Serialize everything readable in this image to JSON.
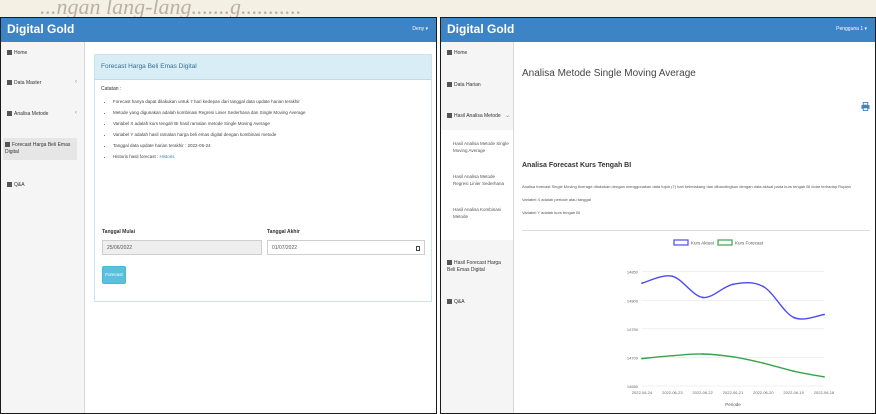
{
  "caption_strip": "...ngan lang-lang.......g...........",
  "left": {
    "app_title": "Digital Gold",
    "user_label": "Deny ▾",
    "sidebar": [
      {
        "label": "Home"
      },
      {
        "label": "Data Master"
      },
      {
        "label": "Analisa Metode"
      },
      {
        "label": "Forecast Harga Beli Emas Digital"
      },
      {
        "label": "Q&A"
      }
    ],
    "panel_title": "Forecast Harga Beli Emas Digital",
    "note_title": "Catatan :",
    "notes": [
      "Forecast hanya dapat dilakukan untuk 7 hari kedepan dari tanggal data update harian terakhir",
      "Metode yang digunakan adalah kombinasi Regresi Linier Sederhana dan Single Moving Average",
      "Variabel X adalah kurs tengah BI hasil ramalan metode Single Moving Average",
      "Variabel Y adalah hasil ramalan harga beli emas digital dengan kombinasi metode",
      "Tanggal data update harian terakhir : 2022-06-24"
    ],
    "history_prefix": "Historis hasil forecast :",
    "history_link": "Historis",
    "tanggal_mulai_label": "Tanggal Mulai",
    "tanggal_mulai_value": "25/06/2022",
    "tanggal_akhir_label": "Tanggal Akhir",
    "tanggal_akhir_value": "01/07/2022",
    "forecast_button": "Forecast"
  },
  "right": {
    "app_title": "Digital Gold",
    "user_label": "Pengguna 1 ▾",
    "sidebar": [
      {
        "label": "Home"
      },
      {
        "label": "Data Harian"
      },
      {
        "label": "Hasil Analisa Metode"
      }
    ],
    "sidebar_sub": [
      {
        "label": "Hasil Analisa Metode Single Moving Average"
      },
      {
        "label": "Hasil Analisa Metode Regresi Linier Sederhana"
      },
      {
        "label": "Hasil Analisa Kombinasi Metode"
      }
    ],
    "sidebar_after": [
      {
        "label": "Hasil Forecast Harga Beli Emas Digital"
      },
      {
        "label": "Q&A"
      }
    ],
    "page_title": "Analisa Metode Single Moving Average",
    "section_title": "Analisa Forecast Kurs Tengah BI",
    "desc_line1": "Analisa forecast Single Moving Average dilakukan dengan menggunakan data tujuh (7) hari kebelakang dan dibandingkan dengan data aktual pada kurs tengah BI dolar terhadap Rupiah",
    "desc_line2": "Variabel X adalah periode atau tanggal",
    "desc_line3": "Variabel Y adalah kurs tengah BI"
  },
  "chart_data": {
    "type": "line",
    "categories": [
      "2022-06-24",
      "2022-06-23",
      "2022-06-22",
      "2022-06-21",
      "2022-06-20",
      "2022-06-19",
      "2022-06-18"
    ],
    "series": [
      {
        "name": "Kurs Aktual",
        "values": [
          14830,
          14842,
          14805,
          14828,
          14824,
          14770,
          14775
        ],
        "color": "#4b4bf0"
      },
      {
        "name": "Kurs Forecast",
        "values": [
          14698,
          14703,
          14706,
          14701,
          14690,
          14676,
          14666
        ],
        "color": "#3aa34a"
      }
    ],
    "xlabel": "Periode",
    "ylabel": "",
    "ylim": [
      14650,
      14860
    ],
    "yticks": [
      14650,
      14700,
      14750,
      14800,
      14850
    ],
    "legend": "top"
  }
}
